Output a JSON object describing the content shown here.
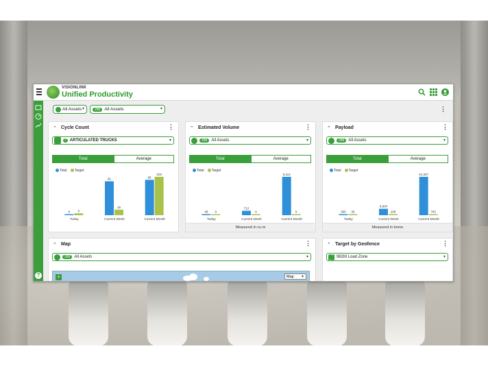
{
  "brand": {
    "small": "VISIONLINK",
    "title": "Unified Productivity"
  },
  "filters": {
    "group_label": "All Assets",
    "count": "288",
    "asset_label": "All Assets"
  },
  "cards": {
    "cycle": {
      "title": "Cycle Count",
      "dropdown_count": "7",
      "dropdown": "ARTICULATED TRUCKS",
      "tab_total": "Total",
      "tab_average": "Average",
      "legend_total": "Total",
      "legend_target": "Target",
      "chart_data": {
        "type": "bar",
        "categories": [
          "Today",
          "Current Week",
          "Current Month"
        ],
        "series": [
          {
            "name": "Total",
            "values": [
              0,
              91,
              95
            ]
          },
          {
            "name": "Target",
            "values": [
              5,
              15,
              103
            ]
          }
        ],
        "bar_labels": {
          "Total": [
            "0",
            "91",
            "95"
          ],
          "Target": [
            "5",
            "15",
            "103"
          ]
        }
      }
    },
    "volume": {
      "title": "Estimated Volume",
      "dropdown_count": "288",
      "dropdown": "All Assets",
      "tab_total": "Total",
      "tab_average": "Average",
      "legend_total": "Total",
      "legend_target": "Target",
      "footer": "Measured in cu.m",
      "chart_data": {
        "type": "bar",
        "categories": [
          "Today",
          "Current Week",
          "Current Month"
        ],
        "series": [
          {
            "name": "Total",
            "values": [
              48,
              712,
              6112
            ]
          },
          {
            "name": "Target",
            "values": [
              0,
              0,
              0
            ]
          }
        ],
        "bar_labels": {
          "Total": [
            "48",
            "712",
            "6,112"
          ],
          "Target": [
            "0",
            "0",
            "0"
          ]
        }
      }
    },
    "payload": {
      "title": "Payload",
      "dropdown_count": "288",
      "dropdown": "All Assets",
      "tab_total": "Total",
      "tab_average": "Average",
      "legend_total": "Total",
      "legend_target": "Target",
      "footer": "Measured in tonne",
      "chart_data": {
        "type": "bar",
        "categories": [
          "Today",
          "Current Week",
          "Current Month"
        ],
        "series": [
          {
            "name": "Total",
            "values": [
              300,
              6904,
              41337
            ]
          },
          {
            "name": "Target",
            "values": [
              35,
              108,
              763
            ]
          }
        ],
        "bar_labels": {
          "Total": [
            "300",
            "6,904",
            "41,337"
          ],
          "Target": [
            "35",
            "108",
            "763"
          ]
        }
      }
    },
    "map": {
      "title": "Map",
      "dropdown_count": "288",
      "dropdown": "All Assets",
      "zoom": "+",
      "map_type": "Map"
    },
    "geofence": {
      "title": "Target by Geofence",
      "dropdown": "982M Load Zone"
    }
  },
  "colors": {
    "brand_green": "#3a9e3a",
    "total_bar": "#2f8fd8",
    "target_bar": "#a8c24a"
  },
  "icons": [
    "menu-icon",
    "search-icon",
    "apps-grid-icon",
    "user-icon",
    "help-icon",
    "chevron-up-icon",
    "kebab-icon",
    "globe-icon",
    "map-icon"
  ]
}
